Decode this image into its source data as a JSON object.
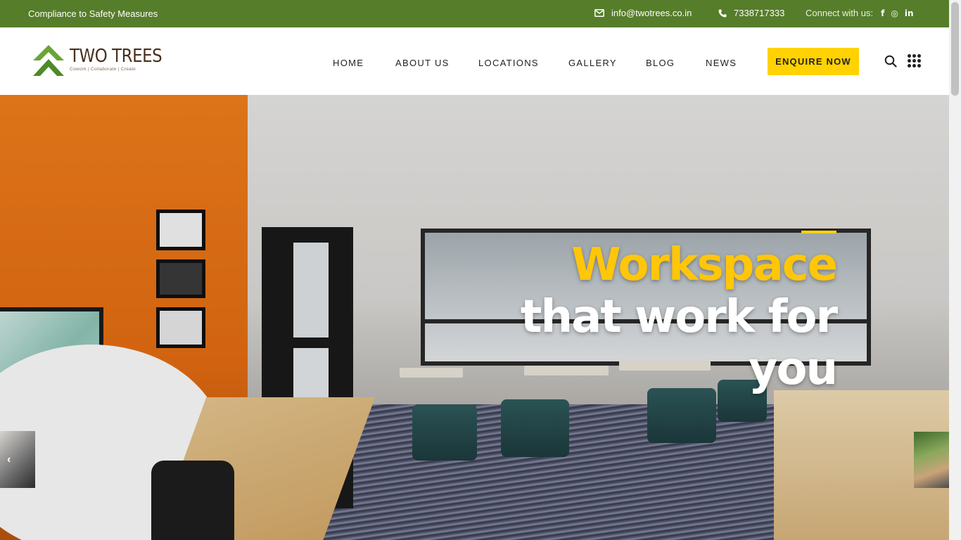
{
  "topbar": {
    "notice": "Compliance to Safety Measures",
    "email": "info@twotrees.co.in",
    "phone": "7338717333",
    "connect_label": "Connect with us:",
    "social": [
      {
        "name": "facebook-icon",
        "glyph": "f"
      },
      {
        "name": "instagram-icon",
        "glyph": "◎"
      },
      {
        "name": "linkedin-icon",
        "glyph": "in"
      }
    ]
  },
  "header": {
    "logo_title": "TWO TREES",
    "logo_tagline": "Cowork | Collaborate | Create",
    "nav": [
      "HOME",
      "ABOUT US",
      "LOCATIONS",
      "GALLERY",
      "BLOG",
      "NEWS"
    ],
    "enquire_label": "ENQUIRE NOW"
  },
  "hero": {
    "title_line1": "Workspace",
    "title_line2": "that work for",
    "title_line3": "you",
    "prev_arrow": "‹"
  },
  "colors": {
    "topbar_green": "#567d2a",
    "accent_yellow": "#ffd200",
    "logo_brown": "#4a2f1c",
    "logo_green": "#6aa534"
  }
}
